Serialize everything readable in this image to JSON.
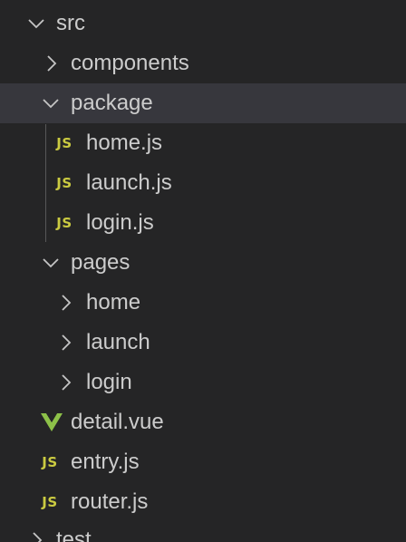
{
  "colors": {
    "background": "#252526",
    "selected_row": "#37373d",
    "text": "#cccccc",
    "js_icon": "#cbcb41",
    "vue_icon": "#8dc149",
    "chevron": "#c5c5c5"
  },
  "tree": {
    "src": {
      "label": "src",
      "icon": "chevron-down-icon"
    },
    "components": {
      "label": "components",
      "icon": "chevron-right-icon"
    },
    "package": {
      "label": "package",
      "icon": "chevron-down-icon"
    },
    "package_home": {
      "label": "home.js",
      "badge": "JS",
      "icon": "js-file-icon"
    },
    "package_launch": {
      "label": "launch.js",
      "badge": "JS",
      "icon": "js-file-icon"
    },
    "package_login": {
      "label": "login.js",
      "badge": "JS",
      "icon": "js-file-icon"
    },
    "pages": {
      "label": "pages",
      "icon": "chevron-down-icon"
    },
    "pages_home": {
      "label": "home",
      "icon": "chevron-right-icon"
    },
    "pages_launch": {
      "label": "launch",
      "icon": "chevron-right-icon"
    },
    "pages_login": {
      "label": "login",
      "icon": "chevron-right-icon"
    },
    "detail_vue": {
      "label": "detail.vue",
      "icon": "vue-file-icon"
    },
    "entry_js": {
      "label": "entry.js",
      "badge": "JS",
      "icon": "js-file-icon"
    },
    "router_js": {
      "label": "router.js",
      "badge": "JS",
      "icon": "js-file-icon"
    },
    "test": {
      "label": "test",
      "icon": "chevron-right-icon"
    }
  }
}
